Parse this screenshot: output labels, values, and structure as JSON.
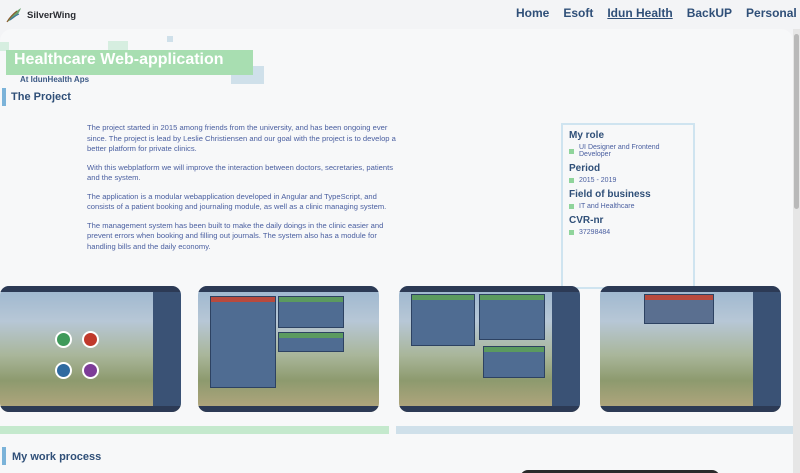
{
  "brand": {
    "name": "SilverWing"
  },
  "nav": {
    "items": [
      {
        "label": "Home",
        "active": false
      },
      {
        "label": "Esoft",
        "active": false
      },
      {
        "label": "Idun Health",
        "active": true
      },
      {
        "label": "BackUP",
        "active": false
      },
      {
        "label": "Personal page",
        "active": false
      }
    ]
  },
  "hero": {
    "title": "Healthcare Web-application",
    "subtitle": "At IdunHealth Aps"
  },
  "project": {
    "heading": "The Project",
    "paragraphs": [
      "The project started in 2015 among friends from the university, and has been ongoing ever since. The project is lead by Leslie Christiensen and our goal with the project is to develop a better platform for private clinics.",
      "With this webplatform we will improve the interaction between doctors, secretaries, patients and the system.",
      "The application is a modular webapplication developed in Angular and TypeScript, and consists of a patient booking and journaling module, as well as a clinic managing system.",
      "The management system has been built to make the daily doings in the clinic easier and prevent errors when booking and filling out journals. The system also has a module for handling bills and the daily economy."
    ]
  },
  "info": {
    "role_label": "My role",
    "role_value": "UI Designer and Frontend Developer",
    "period_label": "Period",
    "period_value": "2015 - 2019",
    "field_label": "Field of business",
    "field_value": "IT and Healthcare",
    "cvr_label": "CVR-nr",
    "cvr_value": "37298484"
  },
  "screenshots": {
    "items": [
      {
        "name": "dashboard-screenshot"
      },
      {
        "name": "booking-screenshot"
      },
      {
        "name": "journal-screenshot"
      },
      {
        "name": "calendar-screenshot"
      }
    ]
  },
  "work": {
    "heading": "My work process"
  },
  "colors": {
    "accent_green": "#a8deb1",
    "accent_blue": "#7bb3d9",
    "nav_text": "#2f4f78",
    "body_text": "#4a5fa0"
  }
}
